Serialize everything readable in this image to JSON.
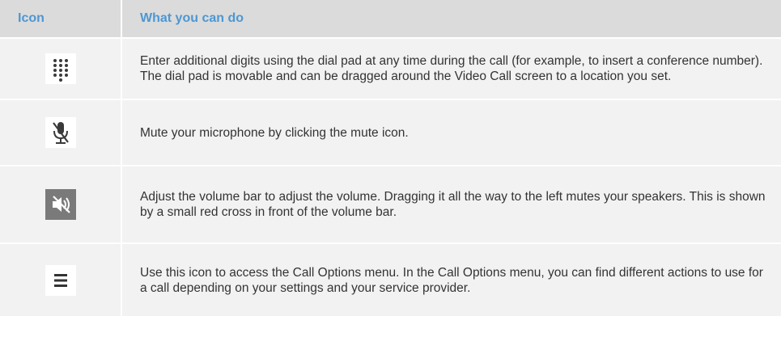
{
  "header": {
    "icon_col": "Icon",
    "desc_col": "What you can do"
  },
  "rows": [
    {
      "icon": "dialpad-icon",
      "text": "Enter additional digits using the dial pad at any time during the call (for example, to insert a conference number). The dial pad is movable and can be dragged around the Video Call screen to a location you set."
    },
    {
      "icon": "mute-microphone-icon",
      "text": "Mute your microphone by clicking the mute icon."
    },
    {
      "icon": "speaker-muted-icon",
      "text": "Adjust the volume bar to adjust the volume. Dragging it all the way to the left mutes your speakers. This is shown by a small red cross in front of the volume bar."
    },
    {
      "icon": "call-options-menu-icon",
      "text": "Use this icon to access the Call Options menu. In the Call Options menu, you can find different actions to use for a call depending on your settings and your service provider."
    }
  ],
  "colors": {
    "header_bg": "#dbdbdb",
    "header_text": "#4d97d3",
    "row_bg": "#f2f2f2",
    "body_text": "#333333"
  }
}
